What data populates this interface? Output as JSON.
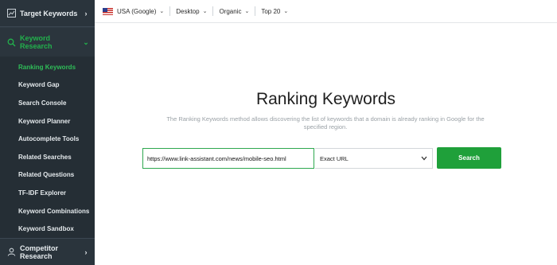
{
  "sidebar": {
    "target_keywords": {
      "label": "Target Keywords",
      "icon": "trend-chart-icon"
    },
    "keyword_research": {
      "label": "Keyword Research",
      "icon": "search-icon"
    },
    "items": [
      {
        "label": "Ranking Keywords",
        "active": true
      },
      {
        "label": "Keyword Gap"
      },
      {
        "label": "Search Console"
      },
      {
        "label": "Keyword Planner"
      },
      {
        "label": "Autocomplete Tools"
      },
      {
        "label": "Related Searches"
      },
      {
        "label": "Related Questions"
      },
      {
        "label": "TF-IDF Explorer"
      },
      {
        "label": "Keyword Combinations"
      },
      {
        "label": "Keyword Sandbox"
      }
    ],
    "competitor_research": {
      "label": "Competitor Research",
      "icon": "user-icon"
    }
  },
  "topbar": {
    "region": "USA (Google)",
    "device": "Desktop",
    "type": "Organic",
    "top": "Top 20"
  },
  "main": {
    "title": "Ranking Keywords",
    "description": "The Ranking Keywords method allows discovering the list of keywords that a domain is already ranking in Google for the specified region.",
    "url_value": "https://www.link-assistant.com/news/mobile-seo.html",
    "mode": "Exact URL",
    "search_label": "Search"
  },
  "colors": {
    "accent": "#1fa03a",
    "sidebar_bg": "#2f3a43",
    "active_text": "#2fbd58"
  }
}
